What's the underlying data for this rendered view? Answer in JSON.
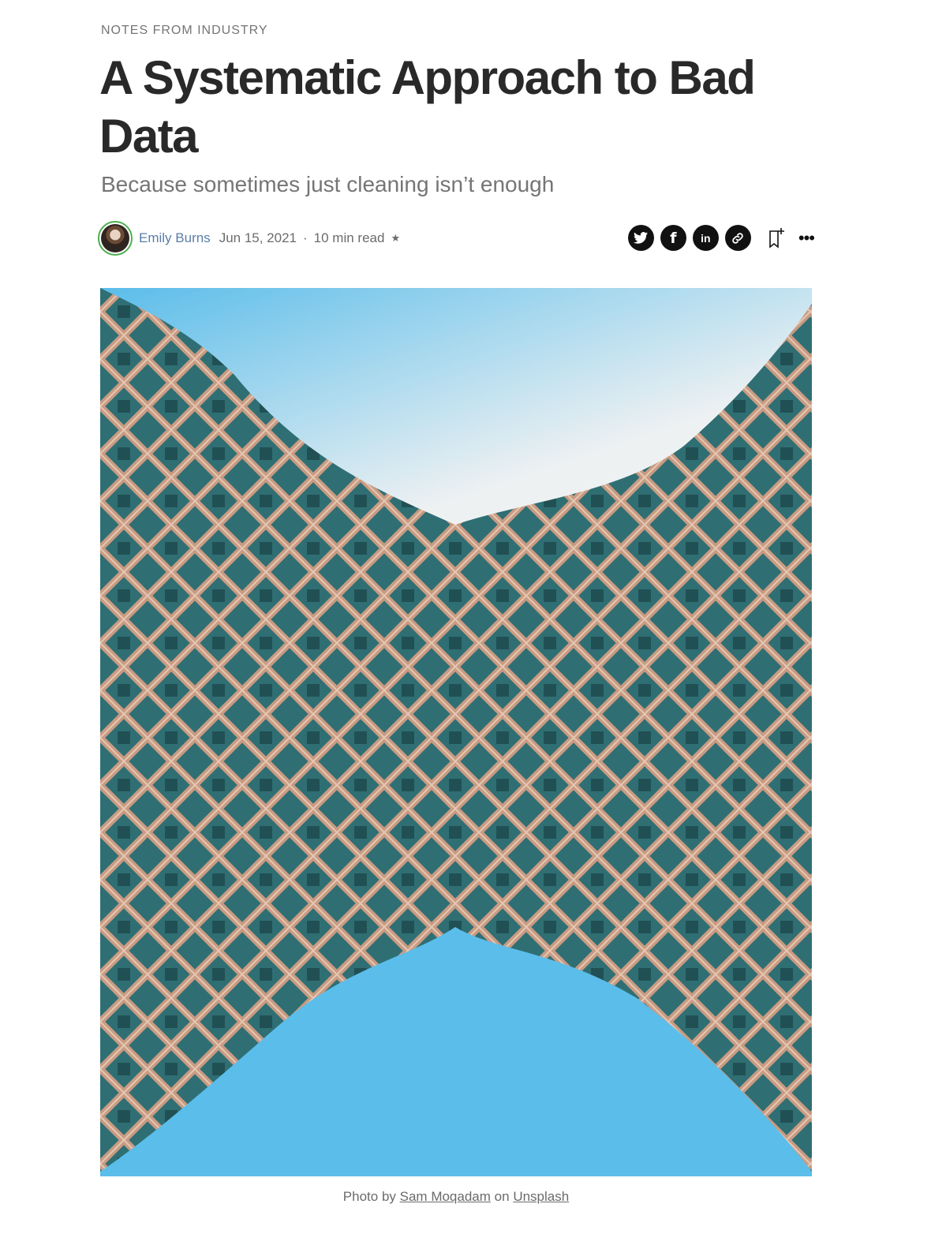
{
  "article": {
    "kicker": "NOTES FROM INDUSTRY",
    "title": "A Systematic Approach to Bad Data",
    "subtitle": "Because sometimes just cleaning isn’t enough"
  },
  "byline": {
    "author": "Emily Burns",
    "date": "Jun 15, 2021",
    "separator": "·",
    "read_time": "10 min read",
    "member_star": "★"
  },
  "share": {
    "icons": [
      "twitter-icon",
      "facebook-icon",
      "linkedin-icon",
      "link-icon",
      "bookmark-icon",
      "more-icon"
    ],
    "facebook_glyph": "f",
    "linkedin_glyph": "in",
    "more_glyph": "•••"
  },
  "hero": {
    "caption_prefix": "Photo by",
    "photographer": "Sam Moqadam",
    "caption_mid": "on",
    "source": "Unsplash",
    "colors": {
      "sky_top": "#eef1f2",
      "sky_blue": "#5bbdea",
      "stone": "#c89b82",
      "tile": "#2f6f74"
    }
  }
}
